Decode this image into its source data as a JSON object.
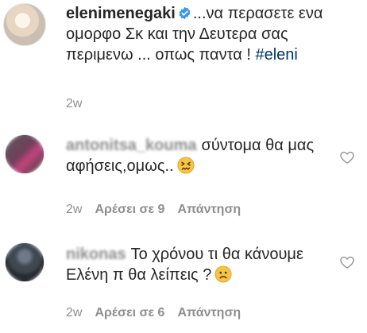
{
  "post": {
    "author": "elenimenegaki",
    "caption": "...να περασετε ενα ομορφο Σκ και την Δευτερα σας περιμενω ... οπως παντα ! ",
    "hashtag": "#eleni",
    "time": "2w"
  },
  "comments": [
    {
      "username": "antonitsa_kouma",
      "text": "σύντομα θα μας αφήσεις,ομως..",
      "emoji": "confounded-face",
      "time": "2w",
      "likes_label": "Αρέσει σε 9",
      "reply_label": "Απάντηση"
    },
    {
      "username": "nikonas",
      "text": "Το χρόνου τι θα κάνουμε Ελένη π θα λείπεις ?",
      "emoji": "sad-face",
      "time": "2w",
      "likes_label": "Αρέσει σε 6",
      "reply_label": "Απάντηση"
    }
  ],
  "colors": {
    "text": "#262626",
    "muted": "#8e8e8e",
    "verified": "#3897f0",
    "hashtag": "#003569"
  },
  "icons": [
    "verified-badge-icon",
    "heart-outline-icon",
    "emoji-icon"
  ]
}
